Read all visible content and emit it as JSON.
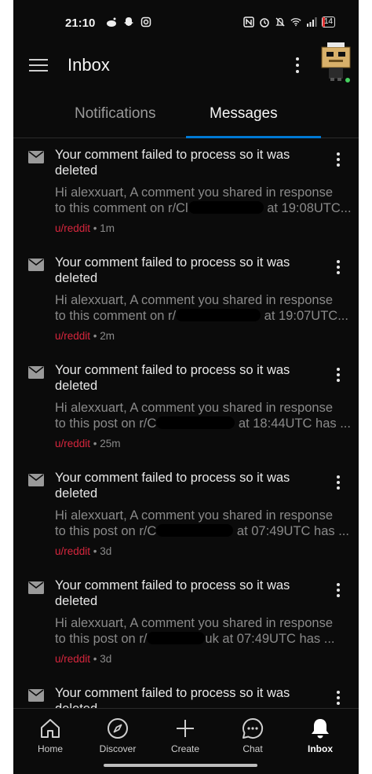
{
  "status_bar": {
    "time": "21:10",
    "battery": "14",
    "battery_color": "#e0302f"
  },
  "header": {
    "title": "Inbox"
  },
  "tabs": [
    {
      "label": "Notifications",
      "active": false
    },
    {
      "label": "Messages",
      "active": true
    }
  ],
  "messages": [
    {
      "subject": "Your comment failed to process so it was deleted",
      "preview_line1": "Hi alexxuart, A comment you shared in response",
      "preview_line2a": "to this comment on r/Cl",
      "preview_line2b": "at 19:08UTC...",
      "author": "u/reddit",
      "separator": " • ",
      "age": "1m"
    },
    {
      "subject": "Your comment failed to process so it was deleted",
      "preview_line1": "Hi alexxuart, A comment you shared in response",
      "preview_line2a": "to this comment on r/",
      "preview_line2b": "at 19:07UTC...",
      "author": "u/reddit",
      "separator": " • ",
      "age": "2m"
    },
    {
      "subject": "Your comment failed to process so it was deleted",
      "preview_line1": "Hi alexxuart, A comment you shared in response",
      "preview_line2a": "to this post on r/C",
      "preview_line2b": "at 18:44UTC has ...",
      "author": "u/reddit",
      "separator": " • ",
      "age": "25m"
    },
    {
      "subject": "Your comment failed to process so it was deleted",
      "preview_line1": "Hi alexxuart, A comment you shared in response",
      "preview_line2a": "to this post on r/C",
      "preview_line2b": "at 07:49UTC has ...",
      "author": "u/reddit",
      "separator": " • ",
      "age": "3d"
    },
    {
      "subject": "Your comment failed to process so it was deleted",
      "preview_line1": "Hi alexxuart, A comment you shared in response",
      "preview_line2a": "to this post on r/",
      "preview_line2b": "uk at 07:49UTC has ...",
      "author": "u/reddit",
      "separator": " • ",
      "age": "3d"
    },
    {
      "subject": "Your comment failed to process so it was deleted",
      "preview_line1": "",
      "preview_line2a": "",
      "preview_line2b": "",
      "author": "",
      "separator": "",
      "age": ""
    }
  ],
  "bottom_nav": [
    {
      "label": "Home",
      "icon": "home-icon",
      "active": false
    },
    {
      "label": "Discover",
      "icon": "compass-icon",
      "active": false
    },
    {
      "label": "Create",
      "icon": "plus-icon",
      "active": false
    },
    {
      "label": "Chat",
      "icon": "chat-bubble-icon",
      "active": false
    },
    {
      "label": "Inbox",
      "icon": "bell-icon",
      "active": true
    }
  ],
  "colors": {
    "background": "#0b0b0b",
    "accent_tab": "#0079d3",
    "author": "#d7263d",
    "online": "#46d160"
  }
}
